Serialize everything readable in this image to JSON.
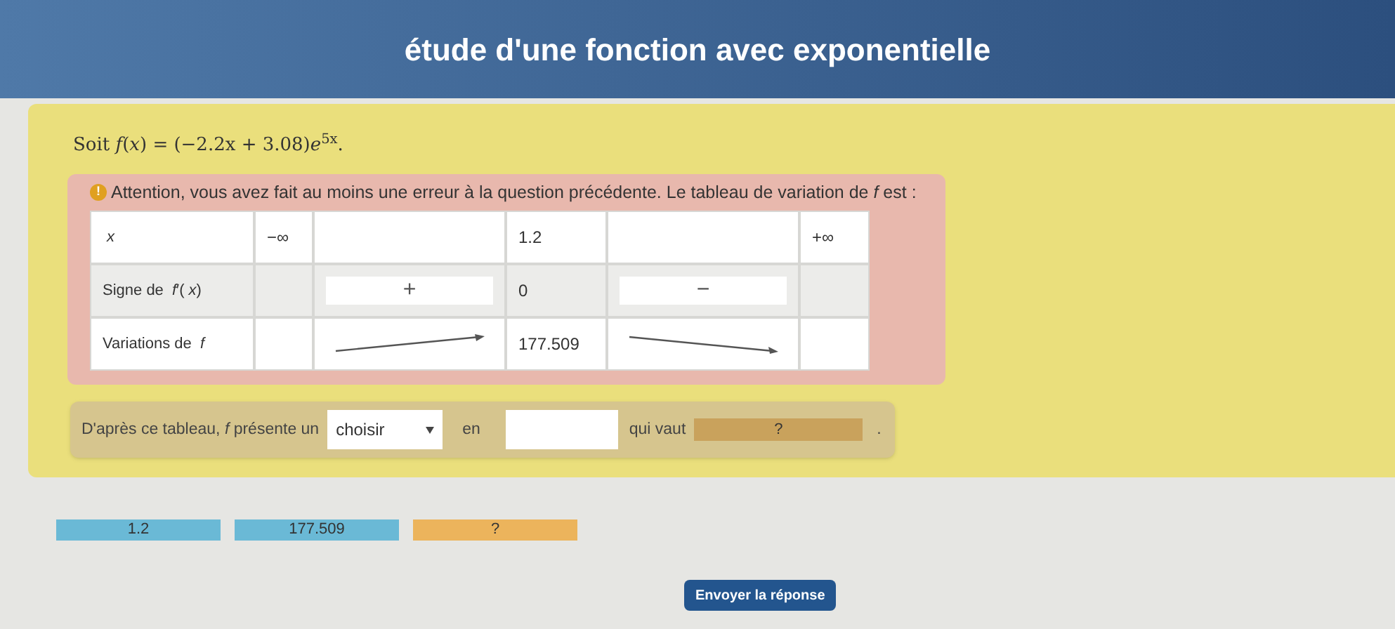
{
  "title": "étude d'une fonction avec exponentielle",
  "statement": "Soit *f*(*x*) = (−2.2x + 3.08)*e*$^{5x}$.",
  "warning": {
    "icon": "!",
    "text": "Attention, vous avez fait au moins une erreur à la question précédente. Le tableau de variation de *f* est :"
  },
  "table": {
    "rows": [
      {
        "label": "*x*",
        "cells": [
          {
            "kind": "text",
            "text": "−∞"
          },
          {
            "kind": "empty"
          },
          {
            "kind": "text",
            "text": "1.2"
          },
          {
            "kind": "empty"
          },
          {
            "kind": "text",
            "text": "+∞"
          }
        ]
      },
      {
        "label": "Signe de *f*′(*x*)",
        "cells": [
          {
            "kind": "empty"
          },
          {
            "kind": "box",
            "text": "+"
          },
          {
            "kind": "text",
            "text": "0"
          },
          {
            "kind": "box",
            "text": "−"
          },
          {
            "kind": "empty"
          }
        ]
      },
      {
        "label": "Variations de *f*",
        "cells": [
          {
            "kind": "empty"
          },
          {
            "kind": "arrow_up"
          },
          {
            "kind": "text",
            "text": "177.509"
          },
          {
            "kind": "arrow_down"
          },
          {
            "kind": "empty"
          }
        ]
      }
    ]
  },
  "question": {
    "text_1": "D'après ce tableau, *f* présente un",
    "dropdown": "choisir",
    "text_2": "en",
    "text_3": "qui vaut",
    "slot": "?",
    "end": "."
  },
  "tiles": [
    {
      "text": "1.2",
      "kind": "number"
    },
    {
      "text": "177.509",
      "kind": "number"
    },
    {
      "text": "?",
      "kind": "unknown"
    }
  ],
  "submit": "Envoyer la réponse"
}
